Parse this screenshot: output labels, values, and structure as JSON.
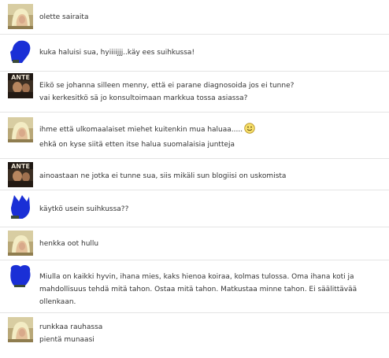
{
  "comments": [
    {
      "avatar": "blonde-woman-avatar",
      "lines": [
        "olette sairaita"
      ]
    },
    {
      "avatar": "blue-scribble-avatar",
      "lines": [
        "kuka haluisi sua, hyiiiijjj..käy ees suihkussa!"
      ]
    },
    {
      "avatar": "poster-avatar",
      "lines": [
        "Eikö se johanna silleen menny, että ei parane diagnosoida jos ei tunne?",
        "vai kerkesitkö sä jo konsultoimaan markkua tossa asiassa?"
      ]
    },
    {
      "avatar": "blonde-woman-avatar",
      "lines": [
        "ihme että ulkomaalaiset miehet kuitenkin mua haluaa.....",
        "ehkä on kyse siitä etten itse halua suomalaisia juntteja"
      ],
      "emoji": "smiley-emoji"
    },
    {
      "avatar": "poster-avatar",
      "lines": [
        "ainoastaan ne jotka ei tunne sua, siis mikäli sun blogiisi on uskomista"
      ]
    },
    {
      "avatar": "blue-scribble-avatar",
      "lines": [
        "käytkö usein suihkussa??"
      ]
    },
    {
      "avatar": "blonde-woman-avatar",
      "lines": [
        "henkka oot hullu"
      ]
    },
    {
      "avatar": "blue-scribble-avatar",
      "lines": [
        "Miulla on kaikki hyvin, ihana mies, kaks hienoa koiraa, kolmas tulossa. Oma ihana koti ja mahdollisuus tehdä mitä tahon. Ostaa mitä tahon. Matkustaa minne tahon. Ei säälittävää ollenkaan."
      ]
    },
    {
      "avatar": "blonde-woman-avatar",
      "lines": [
        "runkkaa rauhassa",
        "pientä munaasi"
      ]
    }
  ],
  "colors": {
    "text": "#333333",
    "divider": "#e4e4e4",
    "scribble_blue": "#1a2fd6"
  }
}
